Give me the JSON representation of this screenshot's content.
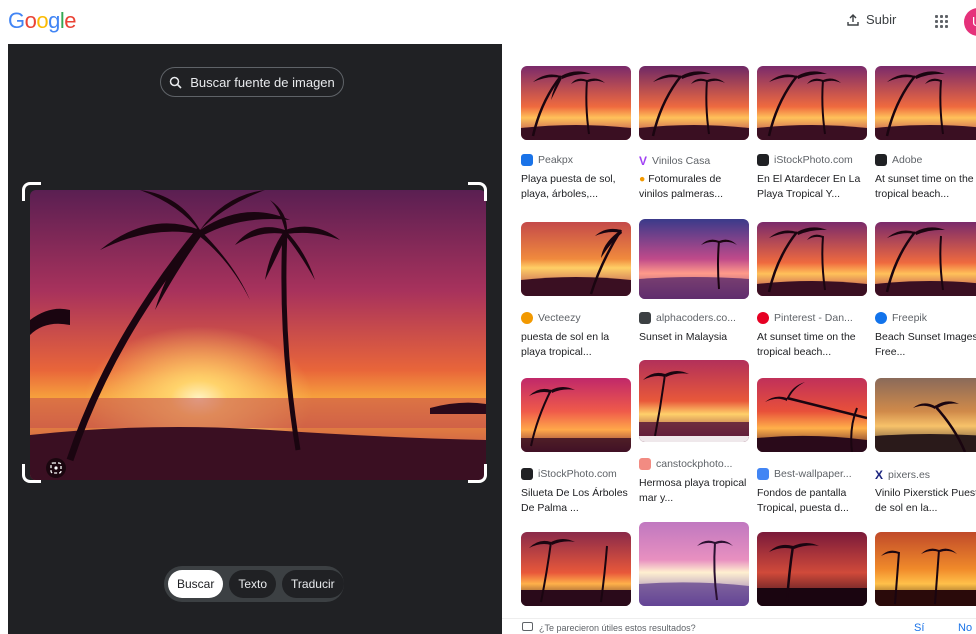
{
  "header": {
    "logo": [
      "G",
      "o",
      "o",
      "g",
      "l",
      "e"
    ],
    "logo_colors": [
      "#4285F4",
      "#EA4335",
      "#FBBC05",
      "#4285F4",
      "#34A853",
      "#EA4335"
    ],
    "upload_label": "Subir",
    "avatar_letter": "U"
  },
  "left_panel": {
    "find_source_label": "Buscar fuente de imagen",
    "tabs": [
      "Buscar",
      "Texto",
      "Traducir"
    ],
    "active_tab": "Buscar"
  },
  "results": [
    {
      "source": "Peakpx",
      "title": "Playa puesta de sol, playa, árboles,...",
      "fav_color": "#1a73e8"
    },
    {
      "source": "Vinilos Casa",
      "title": "Fotomurales de vinilos palmeras...",
      "fav_color": "#a142f4",
      "title_icon": "medal-icon"
    },
    {
      "source": "iStockPhoto.com",
      "title": "En El Atardecer En La Playa Tropical Y...",
      "fav_color": "#202124"
    },
    {
      "source": "Adobe",
      "title": "At sunset time on the tropical beach...",
      "fav_color": "#202124"
    },
    {
      "source": "Vecteezy",
      "title": "puesta de sol en la playa tropical...",
      "fav_color": "#f29900"
    },
    {
      "source": "alphacoders.co...",
      "title": "Sunset in Malaysia",
      "fav_color": "#3c4043"
    },
    {
      "source": "Pinterest - Dan...",
      "title": "At sunset time on the tropical beach...",
      "fav_color": "#e60023"
    },
    {
      "source": "Freepik",
      "title": "Beach Sunset Images - Free...",
      "fav_color": "#1273eb"
    },
    {
      "source": "iStockPhoto.com",
      "title": "Silueta De Los Árboles De Palma ...",
      "fav_color": "#202124"
    },
    {
      "source": "canstockphoto...",
      "title": "Hermosa playa tropical mar y...",
      "fav_color": "#f28b82",
      "thumb_caption": "© CanStockPhoto.com"
    },
    {
      "source": "Best-wallpaper...",
      "title": "Fondos de pantalla Tropical, puesta d...",
      "fav_color": "#4285F4"
    },
    {
      "source": "pixers.es",
      "title": "Vinilo Pixerstick Puesta de sol en la...",
      "fav_color": "#1a237e"
    }
  ],
  "feedback": {
    "question": "¿Te parecieron útiles estos resultados?",
    "yes": "Sí",
    "no": "No"
  }
}
